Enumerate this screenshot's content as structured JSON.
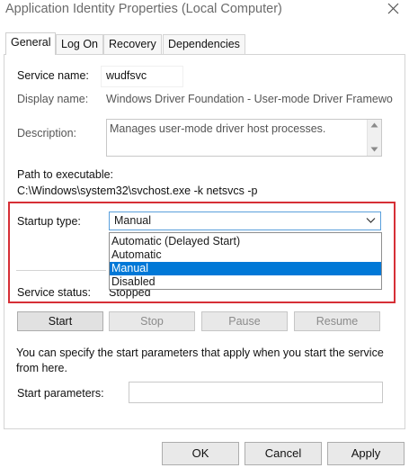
{
  "window": {
    "title": "Application Identity Properties (Local Computer)"
  },
  "tabs": [
    {
      "label": "General"
    },
    {
      "label": "Log On"
    },
    {
      "label": "Recovery"
    },
    {
      "label": "Dependencies"
    }
  ],
  "general": {
    "service_name_label": "Service name:",
    "service_name_value": "wudfsvc",
    "display_name_label": "Display name:",
    "display_name_value": "Windows Driver Foundation - User-mode Driver Framewo",
    "description_label": "Description:",
    "description_value": "Manages user-mode driver host processes.",
    "path_label": "Path to executable:",
    "path_value": "C:\\Windows\\system32\\svchost.exe -k netsvcs -p",
    "startup_type_label": "Startup type:",
    "startup_type_selected": "Manual",
    "startup_type_options": [
      "Automatic (Delayed Start)",
      "Automatic",
      "Manual",
      "Disabled"
    ],
    "service_status_label": "Service status:",
    "service_status_value": "Stopped"
  },
  "service_buttons": {
    "start": "Start",
    "stop": "Stop",
    "pause": "Pause",
    "resume": "Resume"
  },
  "info_text": "You can specify the start parameters that apply when you start the service from here.",
  "start_parameters_label": "Start parameters:",
  "dialog_buttons": {
    "ok": "OK",
    "cancel": "Cancel",
    "apply": "Apply"
  },
  "colors": {
    "highlight": "#0078d7",
    "annotation_border": "#d62f36"
  },
  "icons": {
    "close": "close-icon",
    "dropdown": "chevron-down-icon",
    "scroll_up": "scroll-up-arrow-icon",
    "scroll_down": "scroll-down-arrow-icon"
  }
}
